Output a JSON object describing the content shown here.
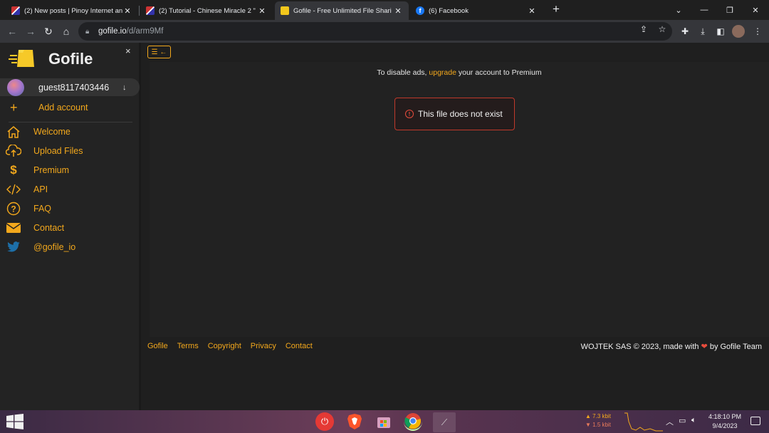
{
  "browser": {
    "tabs": [
      {
        "title": "(2) New posts | Pinoy Internet an",
        "favicon": "shield-icon",
        "color": "#4a6cd4"
      },
      {
        "title": "(2) Tutorial - Chinese Miracle 2 \"",
        "favicon": "shield-icon",
        "color": "#4a6cd4"
      },
      {
        "title": "Gofile - Free Unlimited File Shari",
        "favicon": "gofile-icon",
        "color": "#f3c71c",
        "active": true
      },
      {
        "title": "(6) Facebook",
        "favicon": "facebook-icon",
        "color": "#1877f2"
      }
    ],
    "new_tab": "+",
    "url_host": "gofile.io",
    "url_path": "/d/arm9Mf"
  },
  "sidebar": {
    "brand": "Gofile",
    "close": "×",
    "account": {
      "name": "guest8117403446",
      "arrow": "↓"
    },
    "add_account": {
      "icon": "+",
      "label": "Add account"
    },
    "items": [
      {
        "label": "Welcome",
        "icon": "home-icon"
      },
      {
        "label": "Upload Files",
        "icon": "cloud-upload-icon"
      },
      {
        "label": "Premium",
        "icon": "dollar-icon"
      },
      {
        "label": "API",
        "icon": "code-icon"
      },
      {
        "label": "FAQ",
        "icon": "question-icon"
      },
      {
        "label": "Contact",
        "icon": "envelope-icon"
      },
      {
        "label": "@gofile_io",
        "icon": "twitter-icon"
      }
    ]
  },
  "main": {
    "collapse_label": "☰ ←",
    "ads_prefix": "To disable ads, ",
    "ads_link": "upgrade",
    "ads_suffix": " your account to Premium",
    "alert_icon": "!",
    "alert_text": "This file does not exist"
  },
  "footer": {
    "links": [
      "Gofile",
      "Terms",
      "Copyright",
      "Privacy",
      "Contact"
    ],
    "credit_prefix": "WOJTEK SAS © 2023, made with ",
    "credit_heart": "❤",
    "credit_suffix": " by Gofile Team"
  },
  "taskbar": {
    "net_up": "▲ 7.3 kbit",
    "net_down": "▼ 1.5 kbit",
    "time": "4:18:10 PM",
    "date": "9/4/2023"
  },
  "colors": {
    "accent": "#f3a81c",
    "alert_border": "#c0392b"
  }
}
